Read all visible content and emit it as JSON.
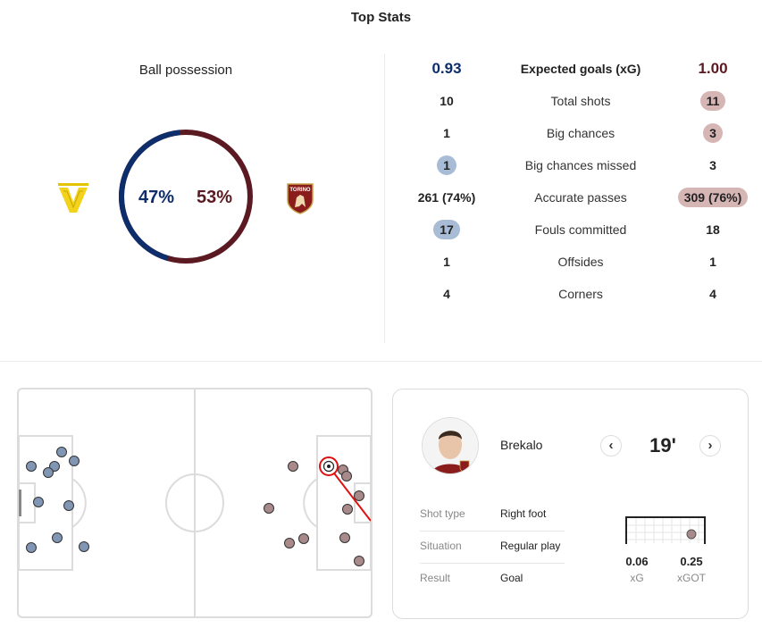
{
  "title": "Top Stats",
  "possession": {
    "label": "Ball possession",
    "home_pct": "47%",
    "away_pct": "53%",
    "home_value": 47,
    "away_value": 53,
    "home_color": "#0e2d6b",
    "away_color": "#5b1a22"
  },
  "teams": {
    "home_logo": "hellas-verona-logo",
    "away_logo": "torino-logo",
    "away_logo_text": "TORINO"
  },
  "stats": [
    {
      "label": "Expected goals (xG)",
      "home": "0.93",
      "away": "1.00",
      "highlight": "none"
    },
    {
      "label": "Total shots",
      "home": "10",
      "away": "11",
      "highlight": "away"
    },
    {
      "label": "Big chances",
      "home": "1",
      "away": "3",
      "highlight": "away"
    },
    {
      "label": "Big chances missed",
      "home": "1",
      "away": "3",
      "highlight": "home"
    },
    {
      "label": "Accurate passes",
      "home": "261 (74%)",
      "away": "309 (76%)",
      "highlight": "away"
    },
    {
      "label": "Fouls committed",
      "home": "17",
      "away": "18",
      "highlight": "home"
    },
    {
      "label": "Offsides",
      "home": "1",
      "away": "1",
      "highlight": "none"
    },
    {
      "label": "Corners",
      "home": "4",
      "away": "4",
      "highlight": "none"
    }
  ],
  "shot_detail": {
    "player": "Brekalo",
    "minute": "19'",
    "rows": [
      {
        "label": "Shot type",
        "value": "Right foot"
      },
      {
        "label": "Situation",
        "value": "Regular play"
      },
      {
        "label": "Result",
        "value": "Goal"
      }
    ],
    "xg": "0.06",
    "xg_label": "xG",
    "xgot": "0.25",
    "xgot_label": "xGOT"
  },
  "shotmap": {
    "home_color": "#8096b4",
    "away_color": "#a88a8a",
    "selected_color": "#e01010"
  }
}
